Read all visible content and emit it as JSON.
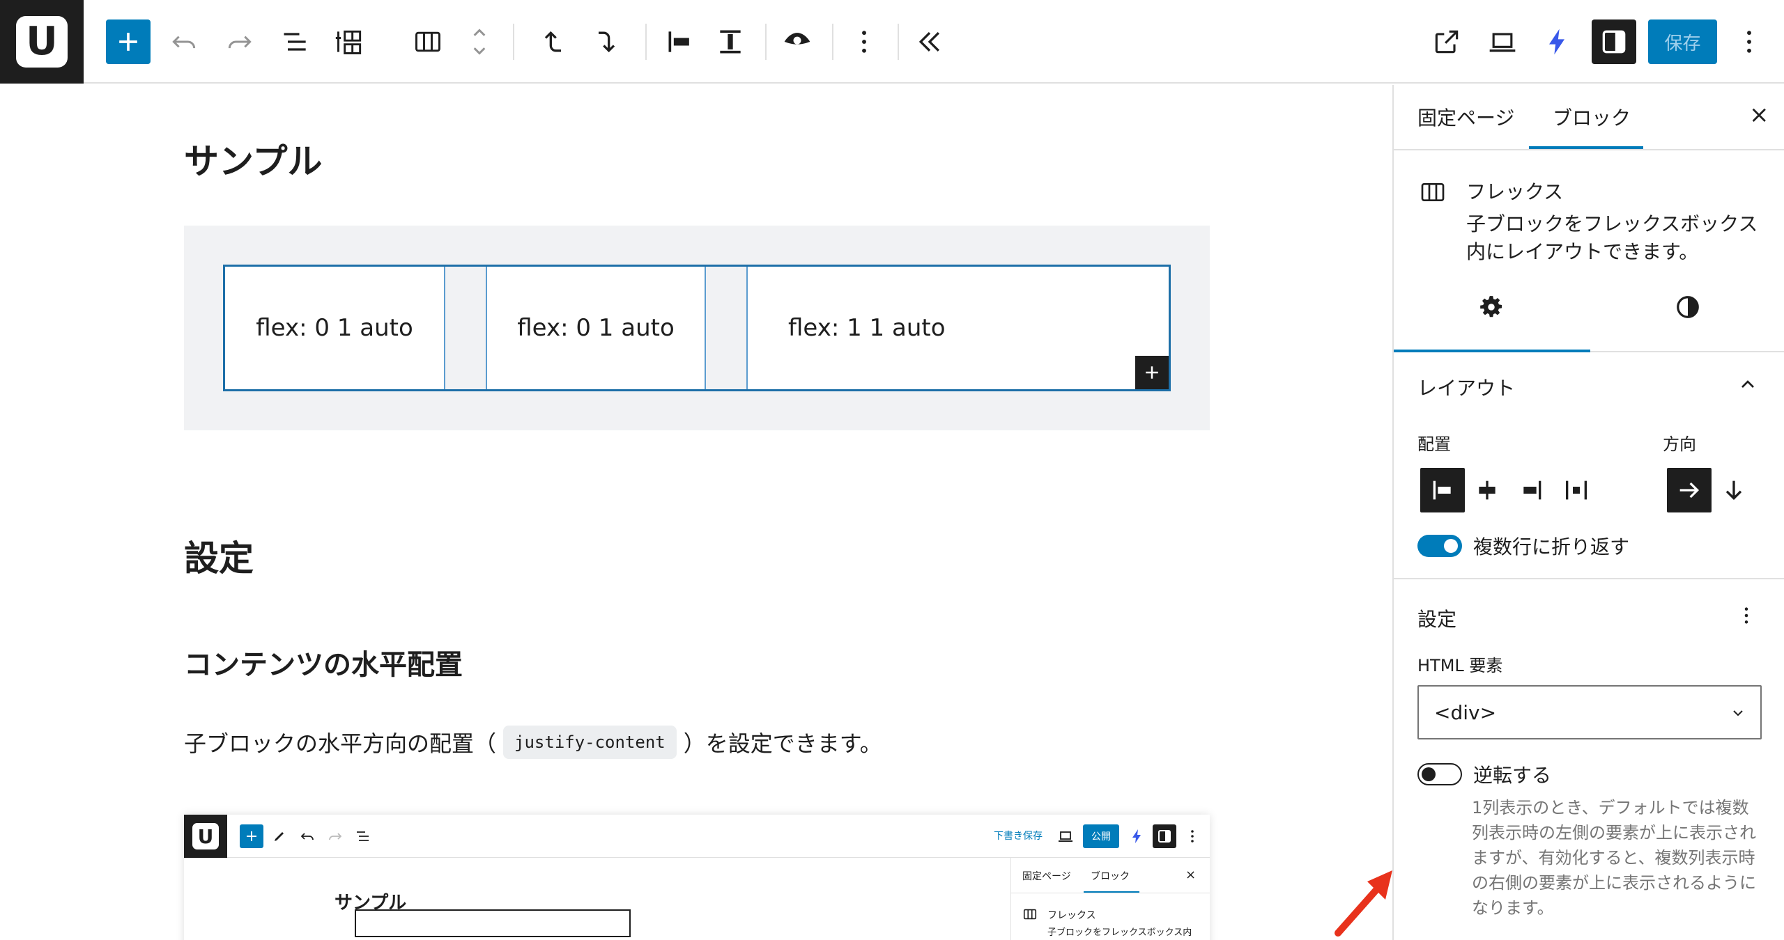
{
  "app": {
    "logo_letter": "U"
  },
  "toolbar": {
    "save_label": "保存"
  },
  "editor": {
    "heading_sample": "サンプル",
    "flex_items": [
      "flex: 0 1 auto",
      "flex: 0 1 auto",
      "flex: 1 1 auto"
    ],
    "heading_settings": "設定",
    "heading_horizontal": "コンテンツの水平配置",
    "para_before": "子ブロックの水平方向の配置（",
    "para_code": "justify-content",
    "para_after": "）を設定できます。"
  },
  "embedded_screenshot": {
    "logo_letter": "U",
    "draft_save": "下書き保存",
    "publish": "公開",
    "title": "サンプル",
    "tab_page": "固定ページ",
    "tab_block": "ブロック",
    "close": "×",
    "block_name": "フレックス",
    "block_desc": "子ブロックをフレックスボックス内"
  },
  "sidebar": {
    "tab_page": "固定ページ",
    "tab_block": "ブロック",
    "close": "×",
    "block_name": "フレックス",
    "block_desc": "子ブロックをフレックスボックス内にレイアウトできます。",
    "layout_panel_title": "レイアウト",
    "justify_label": "配置",
    "direction_label": "方向",
    "wrap_toggle_label": "複数行に折り返す",
    "wrap_toggle_on": true,
    "settings_panel_title": "設定",
    "html_element_label": "HTML 要素",
    "html_element_value": "<div>",
    "reverse_toggle_label": "逆転する",
    "reverse_toggle_on": false,
    "reverse_help": "1列表示のとき、デフォルトでは複数列表示時の左側の要素が上に表示されますが、有効化すると、複数列表示時の右側の要素が上に表示されるようになります。"
  },
  "colors": {
    "accent": "#007cba",
    "dark": "#1e1e1e",
    "annotation_arrow": "#e8321c"
  }
}
